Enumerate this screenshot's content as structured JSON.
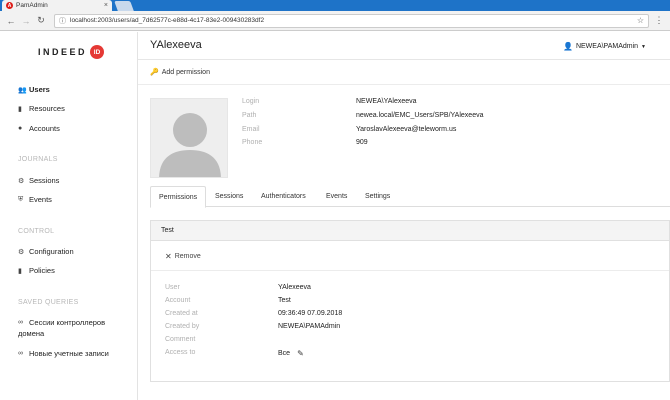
{
  "browser": {
    "tab_title": "PamAdmin",
    "tab_close": "×",
    "url": "localhost:2003/users/ad_7d62577c-e88d-4c17-83e2-009430283df2",
    "icons": {
      "back": "←",
      "forward": "→",
      "reload": "↻",
      "info": "ⓘ",
      "star": "☆",
      "menu": "⋮",
      "favicon": "A"
    }
  },
  "sidebar": {
    "logo_text": "INDEED",
    "logo_badge": "ID",
    "items": [
      {
        "label": "Users",
        "icon": "users-icon"
      },
      {
        "label": "Resources",
        "icon": "server-icon"
      },
      {
        "label": "Accounts",
        "icon": "account-icon"
      }
    ],
    "journals_label": "JOURNALS",
    "journals": [
      {
        "label": "Sessions",
        "icon": "sessions-icon"
      },
      {
        "label": "Events",
        "icon": "shield-icon"
      }
    ],
    "control_label": "CONTROL",
    "control": [
      {
        "label": "Configuration",
        "icon": "gears-icon"
      },
      {
        "label": "Policies",
        "icon": "file-icon"
      }
    ],
    "saved_label": "SAVED QUERIES",
    "saved": [
      {
        "label_line1": "Сессии контроллеров",
        "label_line2": "домена",
        "icon": "link-icon"
      },
      {
        "label": "Новые учетные записи",
        "icon": "link-icon"
      }
    ]
  },
  "header": {
    "title": "YAlexeeva",
    "user": "NEWEA\\PAMAdmin",
    "add_permission": "Add permission"
  },
  "profile": {
    "labels": {
      "login": "Login",
      "path": "Path",
      "email": "Email",
      "phone": "Phone"
    },
    "values": {
      "login": "NEWEA\\YAlexeeva",
      "path": "newea.local/EMC_Users/SPB/YAlexeeva",
      "email": "YaroslavAlexeeva@teleworm.us",
      "phone": "909"
    }
  },
  "tabs": [
    "Permissions",
    "Sessions",
    "Authenticators",
    "Events",
    "Settings"
  ],
  "permission": {
    "title": "Test",
    "remove_label": "Remove",
    "labels": {
      "user": "User",
      "account": "Account",
      "created_at": "Created at",
      "created_by": "Created by",
      "comment": "Comment",
      "access_to": "Access to"
    },
    "values": {
      "user": "YAlexeeva",
      "account": "Test",
      "created_at": "09:36:49 07.09.2018",
      "created_by": "NEWEA\\PAMAdmin",
      "comment": "",
      "access_to": "Все"
    }
  },
  "colors": {
    "titlebar": "#1e73c8",
    "logo_accent": "#e53935",
    "muted_label": "#b0b0b0"
  }
}
